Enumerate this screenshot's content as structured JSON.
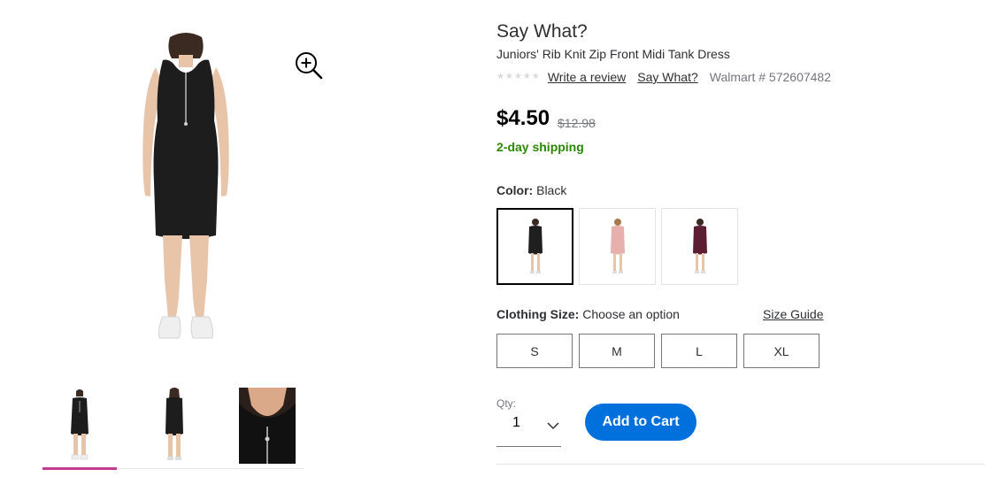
{
  "product": {
    "brand": "Say What?",
    "title": "Juniors' Rib Knit Zip Front Midi Tank Dress",
    "review_link": "Write a review",
    "brand_link": "Say What?",
    "item_number": "Walmart # 572607482",
    "rating_stars": 0
  },
  "pricing": {
    "current": "$4.50",
    "was": "$12.98",
    "shipping": "2-day shipping",
    "shipping_color": "#2a8703"
  },
  "color": {
    "label": "Color:",
    "selected": "Black",
    "swatches": [
      {
        "name": "Black",
        "hex": "#1f1f1f"
      },
      {
        "name": "Pink",
        "hex": "#e7b0ac"
      },
      {
        "name": "Burgundy",
        "hex": "#5b1e33"
      }
    ]
  },
  "size": {
    "label": "Clothing Size:",
    "value": "Choose an option",
    "guide": "Size Guide",
    "options": [
      "S",
      "M",
      "L",
      "XL"
    ]
  },
  "quantity": {
    "label": "Qty:",
    "value": "1"
  },
  "cart": {
    "button_label": "Add to Cart",
    "button_color": "#0071dc"
  },
  "gallery": {
    "thumbnail_count": 3,
    "selected_index": 0,
    "indicator_color": "#c13d8f",
    "zoom_icon": "zoom-in-icon"
  }
}
